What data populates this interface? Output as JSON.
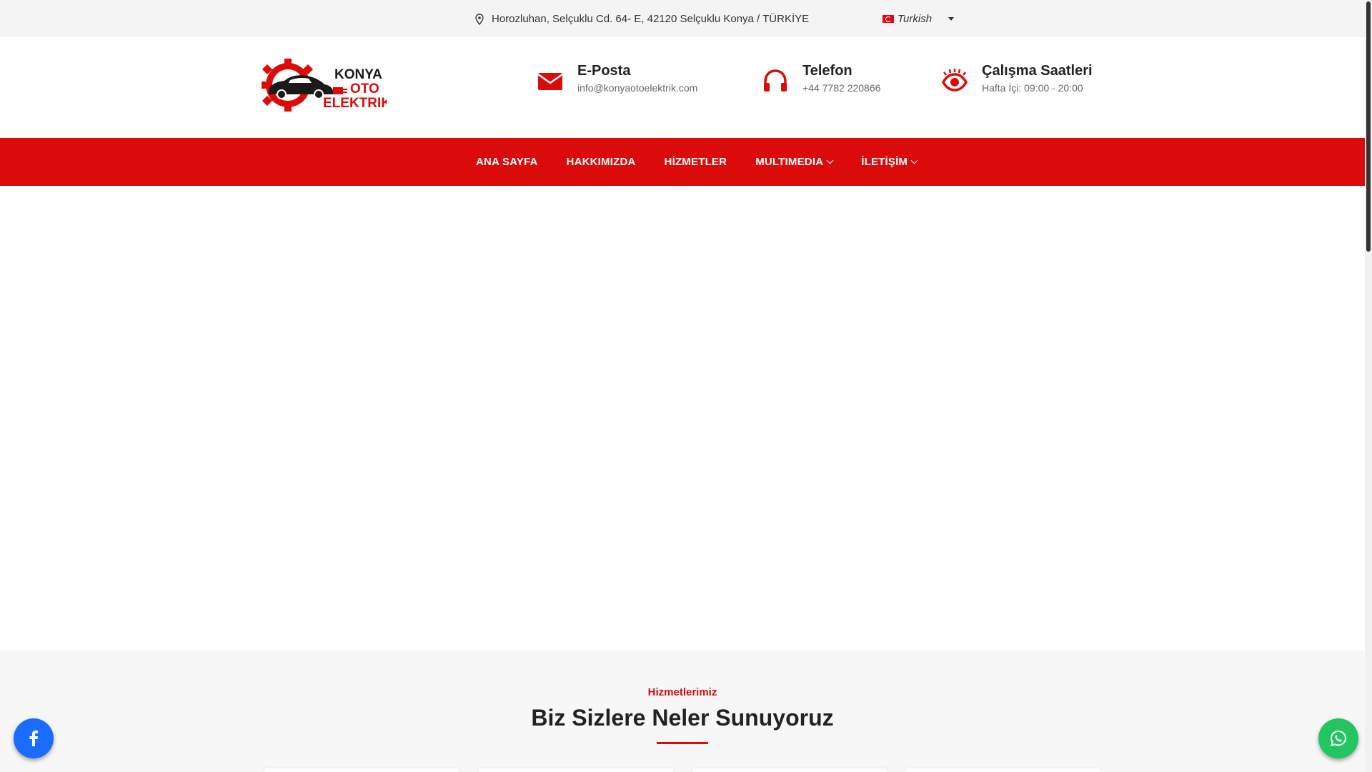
{
  "topbar": {
    "address": "Horozluhan, Selçuklu Cd. 64- E, 42120 Selçuklu Konya / TÜRKİYE",
    "language": "Turkish"
  },
  "header": {
    "logo_text_1": "KONYA",
    "logo_text_2": "OTO",
    "logo_text_3": "ELEKTRIK",
    "email": {
      "title": "E-Posta",
      "value": "info@konyaotoelektrik.com"
    },
    "phone": {
      "title": "Telefon",
      "value": "+44 7782 220866"
    },
    "hours": {
      "title": "Çalışma Saatleri",
      "value": "Hafta İçi: 09:00 - 20:00"
    }
  },
  "nav": {
    "items": [
      {
        "label": "ANA SAYFA",
        "has_dropdown": false
      },
      {
        "label": "HAKKIMIZDA",
        "has_dropdown": false
      },
      {
        "label": "HİZMETLER",
        "has_dropdown": false
      },
      {
        "label": "MULTIMEDIA",
        "has_dropdown": true
      },
      {
        "label": "İLETİŞİM",
        "has_dropdown": true
      }
    ]
  },
  "services": {
    "subtitle": "Hizmetlerimiz",
    "title": "Biz Sizlere Neler Sunuyoruz"
  },
  "floating": {
    "facebook_icon": "facebook-icon",
    "whatsapp_icon": "whatsapp-icon"
  },
  "colors": {
    "brand_red": "#db0b0b",
    "facebook_blue": "#1a6cff",
    "whatsapp_green": "#22c55e"
  }
}
